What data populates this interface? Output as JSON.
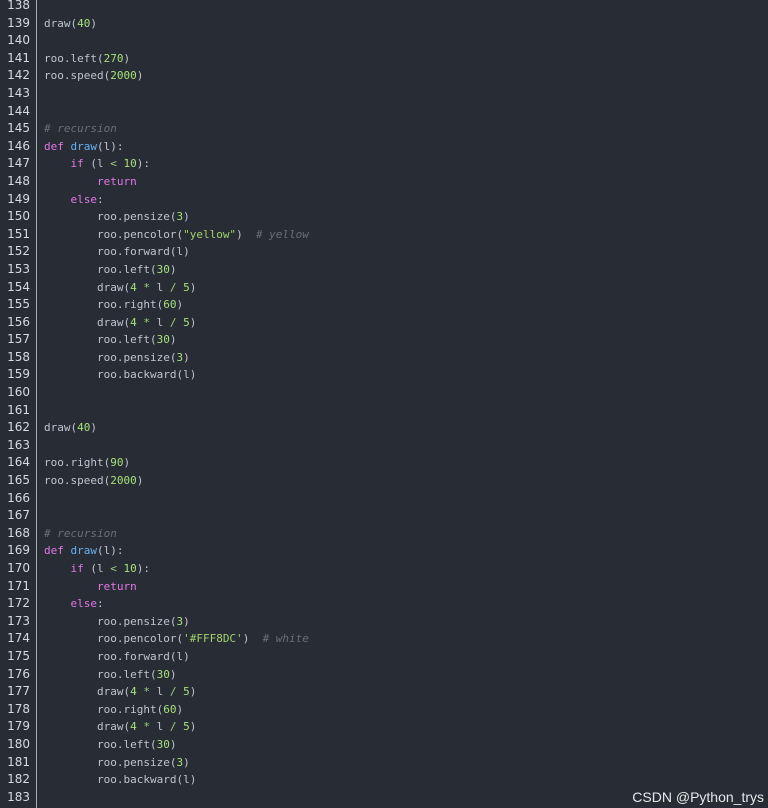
{
  "colors": {
    "background": "#282c34",
    "line_number": "#d7dae0",
    "plain": "#bfc5ce",
    "number": "#a6e07a",
    "keyword": "#e178e6",
    "function": "#67b1f2",
    "comment": "#66707d",
    "string": "#9fd26d"
  },
  "editor": {
    "lines": [
      {
        "n": "138",
        "tokens": []
      },
      {
        "n": "139",
        "tokens": [
          {
            "t": "draw(",
            "k": "plain"
          },
          {
            "t": "40",
            "k": "num"
          },
          {
            "t": ")",
            "k": "plain"
          }
        ]
      },
      {
        "n": "140",
        "tokens": []
      },
      {
        "n": "141",
        "tokens": [
          {
            "t": "roo.left(",
            "k": "plain"
          },
          {
            "t": "270",
            "k": "num"
          },
          {
            "t": ")",
            "k": "plain"
          }
        ]
      },
      {
        "n": "142",
        "tokens": [
          {
            "t": "roo.speed(",
            "k": "plain"
          },
          {
            "t": "2000",
            "k": "num"
          },
          {
            "t": ")",
            "k": "plain"
          }
        ]
      },
      {
        "n": "143",
        "tokens": []
      },
      {
        "n": "144",
        "tokens": []
      },
      {
        "n": "145",
        "tokens": [
          {
            "t": "# recursion",
            "k": "cmt"
          }
        ]
      },
      {
        "n": "146",
        "tokens": [
          {
            "t": "def ",
            "k": "kw"
          },
          {
            "t": "draw",
            "k": "fn"
          },
          {
            "t": "(l):",
            "k": "plain"
          }
        ]
      },
      {
        "n": "147",
        "tokens": [
          {
            "t": "    ",
            "k": "plain"
          },
          {
            "t": "if",
            "k": "kw"
          },
          {
            "t": " (l ",
            "k": "plain"
          },
          {
            "t": "<",
            "k": "op"
          },
          {
            "t": " ",
            "k": "plain"
          },
          {
            "t": "10",
            "k": "num"
          },
          {
            "t": "):",
            "k": "plain"
          }
        ]
      },
      {
        "n": "148",
        "tokens": [
          {
            "t": "        ",
            "k": "plain"
          },
          {
            "t": "return",
            "k": "kw"
          }
        ]
      },
      {
        "n": "149",
        "tokens": [
          {
            "t": "    ",
            "k": "plain"
          },
          {
            "t": "else",
            "k": "kw"
          },
          {
            "t": ":",
            "k": "plain"
          }
        ]
      },
      {
        "n": "150",
        "tokens": [
          {
            "t": "        roo.pensize(",
            "k": "plain"
          },
          {
            "t": "3",
            "k": "num"
          },
          {
            "t": ")",
            "k": "plain"
          }
        ]
      },
      {
        "n": "151",
        "tokens": [
          {
            "t": "        roo.pencolor(",
            "k": "plain"
          },
          {
            "t": "\"yellow\"",
            "k": "str"
          },
          {
            "t": ")  ",
            "k": "plain"
          },
          {
            "t": "# yellow",
            "k": "cmt"
          }
        ]
      },
      {
        "n": "152",
        "tokens": [
          {
            "t": "        roo.forward(l)",
            "k": "plain"
          }
        ]
      },
      {
        "n": "153",
        "tokens": [
          {
            "t": "        roo.left(",
            "k": "plain"
          },
          {
            "t": "30",
            "k": "num"
          },
          {
            "t": ")",
            "k": "plain"
          }
        ]
      },
      {
        "n": "154",
        "tokens": [
          {
            "t": "        draw(",
            "k": "plain"
          },
          {
            "t": "4",
            "k": "num"
          },
          {
            "t": " ",
            "k": "plain"
          },
          {
            "t": "*",
            "k": "op"
          },
          {
            "t": " l ",
            "k": "plain"
          },
          {
            "t": "/",
            "k": "op"
          },
          {
            "t": " ",
            "k": "plain"
          },
          {
            "t": "5",
            "k": "num"
          },
          {
            "t": ")",
            "k": "plain"
          }
        ]
      },
      {
        "n": "155",
        "tokens": [
          {
            "t": "        roo.right(",
            "k": "plain"
          },
          {
            "t": "60",
            "k": "num"
          },
          {
            "t": ")",
            "k": "plain"
          }
        ]
      },
      {
        "n": "156",
        "tokens": [
          {
            "t": "        draw(",
            "k": "plain"
          },
          {
            "t": "4",
            "k": "num"
          },
          {
            "t": " ",
            "k": "plain"
          },
          {
            "t": "*",
            "k": "op"
          },
          {
            "t": " l ",
            "k": "plain"
          },
          {
            "t": "/",
            "k": "op"
          },
          {
            "t": " ",
            "k": "plain"
          },
          {
            "t": "5",
            "k": "num"
          },
          {
            "t": ")",
            "k": "plain"
          }
        ]
      },
      {
        "n": "157",
        "tokens": [
          {
            "t": "        roo.left(",
            "k": "plain"
          },
          {
            "t": "30",
            "k": "num"
          },
          {
            "t": ")",
            "k": "plain"
          }
        ]
      },
      {
        "n": "158",
        "tokens": [
          {
            "t": "        roo.pensize(",
            "k": "plain"
          },
          {
            "t": "3",
            "k": "num"
          },
          {
            "t": ")",
            "k": "plain"
          }
        ]
      },
      {
        "n": "159",
        "tokens": [
          {
            "t": "        roo.backward(l)",
            "k": "plain"
          }
        ]
      },
      {
        "n": "160",
        "tokens": []
      },
      {
        "n": "161",
        "tokens": []
      },
      {
        "n": "162",
        "tokens": [
          {
            "t": "draw(",
            "k": "plain"
          },
          {
            "t": "40",
            "k": "num"
          },
          {
            "t": ")",
            "k": "plain"
          }
        ]
      },
      {
        "n": "163",
        "tokens": []
      },
      {
        "n": "164",
        "tokens": [
          {
            "t": "roo.right(",
            "k": "plain"
          },
          {
            "t": "90",
            "k": "num"
          },
          {
            "t": ")",
            "k": "plain"
          }
        ]
      },
      {
        "n": "165",
        "tokens": [
          {
            "t": "roo.speed(",
            "k": "plain"
          },
          {
            "t": "2000",
            "k": "num"
          },
          {
            "t": ")",
            "k": "plain"
          }
        ]
      },
      {
        "n": "166",
        "tokens": []
      },
      {
        "n": "167",
        "tokens": []
      },
      {
        "n": "168",
        "tokens": [
          {
            "t": "# recursion",
            "k": "cmt"
          }
        ]
      },
      {
        "n": "169",
        "tokens": [
          {
            "t": "def ",
            "k": "kw"
          },
          {
            "t": "draw",
            "k": "fn"
          },
          {
            "t": "(l):",
            "k": "plain"
          }
        ]
      },
      {
        "n": "170",
        "tokens": [
          {
            "t": "    ",
            "k": "plain"
          },
          {
            "t": "if",
            "k": "kw"
          },
          {
            "t": " (l ",
            "k": "plain"
          },
          {
            "t": "<",
            "k": "op"
          },
          {
            "t": " ",
            "k": "plain"
          },
          {
            "t": "10",
            "k": "num"
          },
          {
            "t": "):",
            "k": "plain"
          }
        ]
      },
      {
        "n": "171",
        "tokens": [
          {
            "t": "        ",
            "k": "plain"
          },
          {
            "t": "return",
            "k": "kw"
          }
        ]
      },
      {
        "n": "172",
        "tokens": [
          {
            "t": "    ",
            "k": "plain"
          },
          {
            "t": "else",
            "k": "kw"
          },
          {
            "t": ":",
            "k": "plain"
          }
        ]
      },
      {
        "n": "173",
        "tokens": [
          {
            "t": "        roo.pensize(",
            "k": "plain"
          },
          {
            "t": "3",
            "k": "num"
          },
          {
            "t": ")",
            "k": "plain"
          }
        ]
      },
      {
        "n": "174",
        "tokens": [
          {
            "t": "        roo.pencolor(",
            "k": "plain"
          },
          {
            "t": "'#FFF8DC'",
            "k": "str"
          },
          {
            "t": ")  ",
            "k": "plain"
          },
          {
            "t": "# white",
            "k": "cmt"
          }
        ]
      },
      {
        "n": "175",
        "tokens": [
          {
            "t": "        roo.forward(l)",
            "k": "plain"
          }
        ]
      },
      {
        "n": "176",
        "tokens": [
          {
            "t": "        roo.left(",
            "k": "plain"
          },
          {
            "t": "30",
            "k": "num"
          },
          {
            "t": ")",
            "k": "plain"
          }
        ]
      },
      {
        "n": "177",
        "tokens": [
          {
            "t": "        draw(",
            "k": "plain"
          },
          {
            "t": "4",
            "k": "num"
          },
          {
            "t": " ",
            "k": "plain"
          },
          {
            "t": "*",
            "k": "op"
          },
          {
            "t": " l ",
            "k": "plain"
          },
          {
            "t": "/",
            "k": "op"
          },
          {
            "t": " ",
            "k": "plain"
          },
          {
            "t": "5",
            "k": "num"
          },
          {
            "t": ")",
            "k": "plain"
          }
        ]
      },
      {
        "n": "178",
        "tokens": [
          {
            "t": "        roo.right(",
            "k": "plain"
          },
          {
            "t": "60",
            "k": "num"
          },
          {
            "t": ")",
            "k": "plain"
          }
        ]
      },
      {
        "n": "179",
        "tokens": [
          {
            "t": "        draw(",
            "k": "plain"
          },
          {
            "t": "4",
            "k": "num"
          },
          {
            "t": " ",
            "k": "plain"
          },
          {
            "t": "*",
            "k": "op"
          },
          {
            "t": " l ",
            "k": "plain"
          },
          {
            "t": "/",
            "k": "op"
          },
          {
            "t": " ",
            "k": "plain"
          },
          {
            "t": "5",
            "k": "num"
          },
          {
            "t": ")",
            "k": "plain"
          }
        ]
      },
      {
        "n": "180",
        "tokens": [
          {
            "t": "        roo.left(",
            "k": "plain"
          },
          {
            "t": "30",
            "k": "num"
          },
          {
            "t": ")",
            "k": "plain"
          }
        ]
      },
      {
        "n": "181",
        "tokens": [
          {
            "t": "        roo.pensize(",
            "k": "plain"
          },
          {
            "t": "3",
            "k": "num"
          },
          {
            "t": ")",
            "k": "plain"
          }
        ]
      },
      {
        "n": "182",
        "tokens": [
          {
            "t": "        roo.backward(l)",
            "k": "plain"
          }
        ]
      },
      {
        "n": "183",
        "tokens": []
      }
    ]
  },
  "watermark": {
    "text": "CSDN @Python_trys"
  }
}
